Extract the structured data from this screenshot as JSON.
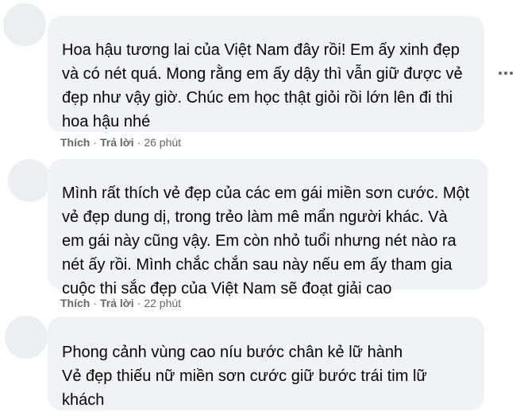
{
  "comments": [
    {
      "text": "Hoa hậu tương lai của Việt Nam đây rồi! Em ấy xinh đẹp\nvà có nét quá. Mong rằng em ấy dậy thì vẫn giữ được vẻ\nđẹp như vậy giờ. Chúc em học thật giỏi rồi lớn lên đi thi\nhoa hậu nhé",
      "like": "Thích",
      "reply": "Trả lời",
      "time": "26 phút"
    },
    {
      "text": "Mình rất thích vẻ đẹp của các em gái miền sơn cước. Một\nvẻ đẹp dung dị, trong trẻo làm mê mẩn người khác. Và\nem gái này cũng vậy. Em còn nhỏ tuổi nhưng nét nào ra\nnét ấy rồi. Mình chắc chắn sau này nếu em ấy tham gia\ncuộc thi sắc đẹp của Việt Nam sẽ đoạt giải cao",
      "like": "Thích",
      "reply": "Trả lời",
      "time": "22 phút"
    },
    {
      "text": "Phong cảnh vùng cao níu bước chân kẻ lữ hành\nVẻ đẹp thiếu nữ miền sơn cước giữ bước trái tim lữ\nkhách"
    }
  ],
  "separator": "·",
  "icons": {
    "more": "more-horizontal-icon"
  },
  "colors": {
    "bubble": "#f0f2f5",
    "meta": "#65676b",
    "text": "#050505"
  }
}
